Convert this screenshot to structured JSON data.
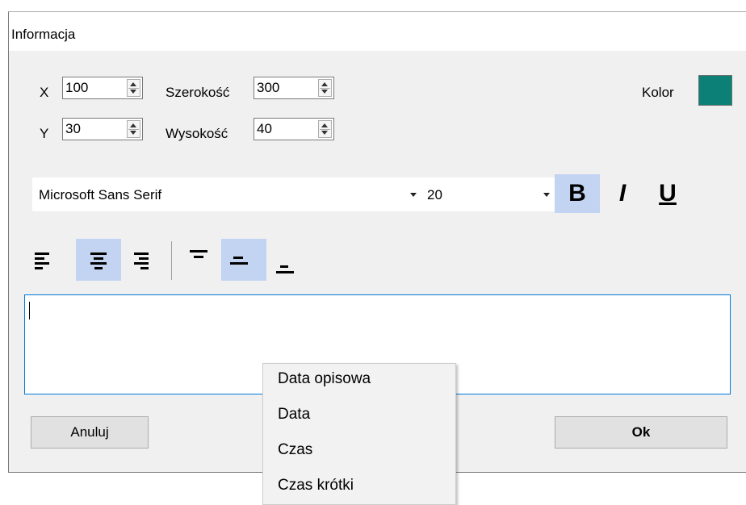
{
  "window": {
    "title": "Informacja"
  },
  "position": {
    "x_label": "X",
    "x_value": "100",
    "y_label": "Y",
    "y_value": "30",
    "width_label": "Szerokość",
    "width_value": "300",
    "height_label": "Wysokość",
    "height_value": "40"
  },
  "color": {
    "label": "Kolor",
    "value": "#0c8076"
  },
  "font": {
    "family": "Microsoft Sans Serif",
    "size": "20",
    "bold_label": "B",
    "bold_active": true,
    "italic_label": "I",
    "italic_active": false,
    "underline_label": "U",
    "underline_active": false
  },
  "alignment": {
    "horizontal": [
      "left",
      "center",
      "right"
    ],
    "horizontal_selected": "center",
    "vertical": [
      "top",
      "middle",
      "bottom"
    ],
    "vertical_selected": "middle"
  },
  "text_area": {
    "value": ""
  },
  "buttons": {
    "cancel": "Anuluj",
    "ok": "Ok"
  },
  "context_menu": {
    "items": [
      "Data opisowa",
      "Data",
      "Czas",
      "Czas krótki"
    ]
  }
}
